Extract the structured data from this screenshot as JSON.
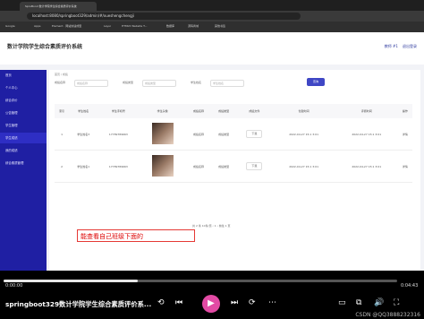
{
  "browser": {
    "tab_title": "SpruBond 数计学院学生综合素质评价系统",
    "url": "localhost:8080/springboot329/admin/#/xueshengchengji",
    "bookmarks": [
      "Google",
      "Apps",
      "Element · 网站快速成型",
      "Layui",
      "HTML5 Website T...",
      "数据库",
      "源码商城",
      "其他书签"
    ]
  },
  "app": {
    "title": "数计学院学生综合素质评价系统",
    "header_right": [
      "教师 #1",
      "退出登录"
    ]
  },
  "sidebar": {
    "items": [
      "首页",
      "个人中心",
      "综合评价",
      "公告管理",
      "学生管理",
      "学生成绩",
      "我的成绩",
      "综合素质管理"
    ],
    "active_index": 5
  },
  "content": {
    "breadcrumb": "首页 / 成绩",
    "filters": [
      {
        "label": "成绩名称",
        "placeholder": "成绩名称"
      },
      {
        "label": "成绩类型",
        "placeholder": "成绩类型"
      },
      {
        "label": "学生姓名",
        "placeholder": "学生姓名"
      }
    ],
    "search_label": "查询",
    "table": {
      "headers": [
        "索引",
        "学生姓名",
        "学生手机号",
        "学生头像",
        "成绩名称",
        "成绩类型",
        "成绩文件",
        "创建时间",
        "评阅时间",
        "操作"
      ],
      "rows": [
        [
          "1",
          "学生姓名3",
          "17789789663",
          "",
          "成绩名称",
          "成绩类型",
          "下载",
          "2022-04-27 15:1 3:01",
          "2022-04-27 15:1 3:01",
          "详情"
        ],
        [
          "2",
          "学生姓名1",
          "17789789663",
          "",
          "成绩名称",
          "成绩类型",
          "下载",
          "2022-04-27 15:1 3:01",
          "2022-04-27 15:1 3:01",
          "详情"
        ]
      ]
    },
    "pager": "共 2 条   10条/页   ‹ 1 ›   前往 1 页",
    "caption": "能查看自己班级下面的"
  },
  "player": {
    "current_time": "0:00:00",
    "total_time": "0:04:43",
    "progress_fraction": 0.34,
    "title": "springboot329数计学院学生综合素质评价系...",
    "watermark": "CSDN @QQ3888232316",
    "controls": [
      "⟲",
      "⏮",
      "▶",
      "⏭",
      "⟳",
      "⋯",
      "▭",
      "⧉",
      "🔊",
      "⛶"
    ]
  },
  "colors": {
    "sidebar": "#1f1fa3",
    "accent": "#3f47c5",
    "play": "#e24aa4",
    "caption_border": "#e53935"
  }
}
